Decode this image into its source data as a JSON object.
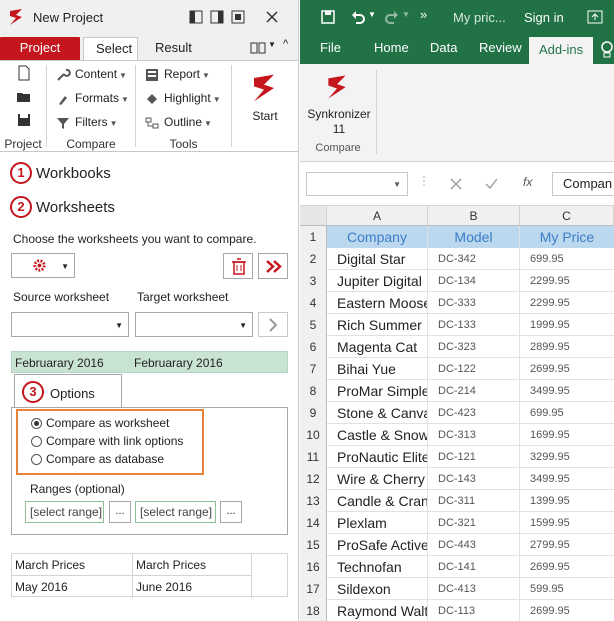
{
  "left": {
    "window_title": "New Project",
    "tabs": [
      "Project",
      "Select",
      "Result"
    ],
    "ribbon": {
      "compare_items": [
        "Content",
        "Formats",
        "Filters"
      ],
      "tools_items": [
        "Report",
        "Highlight",
        "Outline"
      ],
      "start_label": "Start",
      "project_label": "Project",
      "compare_label": "Compare",
      "tools_label": "Tools"
    },
    "steps": [
      {
        "num": "1",
        "label": "Workbooks"
      },
      {
        "num": "2",
        "label": "Worksheets"
      },
      {
        "num": "3",
        "label": "Options"
      }
    ],
    "instruction": "Choose the worksheets you want to compare.",
    "source_label": "Source worksheet",
    "target_label": "Target worksheet",
    "selected_source": "Februarary 2016",
    "selected_target": "Februarary 2016",
    "options": [
      "Compare as worksheet",
      "Compare with link options",
      "Compare as database"
    ],
    "ranges_label": "Ranges (optional)",
    "range_placeholder": "[select range]",
    "browse_label": "...",
    "bottom_rows": [
      [
        "March Prices",
        "March Prices"
      ],
      [
        "May 2016",
        "June 2016"
      ]
    ]
  },
  "right": {
    "title": "My pric...",
    "sign_in": "Sign in",
    "tabs": [
      "File",
      "Home",
      "Data",
      "Review",
      "Add-ins"
    ],
    "addin_label": "Synkronizer 11",
    "addin_group": "Compare",
    "formula_fx": "fx",
    "formula_text": "Compan",
    "columns": [
      "A",
      "B",
      "C"
    ],
    "header": {
      "company": "Company",
      "model": "Model",
      "price": "My Price"
    },
    "rows": [
      {
        "n": "2",
        "company": "Digital Star",
        "model": "DC-342",
        "price": "699.95"
      },
      {
        "n": "3",
        "company": "Jupiter Digital",
        "model": "DC-134",
        "price": "2299.95"
      },
      {
        "n": "4",
        "company": "Eastern Moose",
        "model": "DC-333",
        "price": "2299.95"
      },
      {
        "n": "5",
        "company": "Rich Summer",
        "model": "DC-133",
        "price": "1999.95"
      },
      {
        "n": "6",
        "company": "Magenta Cat",
        "model": "DC-323",
        "price": "2899.95"
      },
      {
        "n": "7",
        "company": "Bihai Yue",
        "model": "DC-122",
        "price": "2699.95"
      },
      {
        "n": "8",
        "company": "ProMar Simple",
        "model": "DC-214",
        "price": "3499.95"
      },
      {
        "n": "9",
        "company": "Stone & Canvas",
        "model": "DC-423",
        "price": "699.95"
      },
      {
        "n": "10",
        "company": "Castle & Snow",
        "model": "DC-313",
        "price": "1699.95"
      },
      {
        "n": "11",
        "company": "ProNautic Elite",
        "model": "DC-121",
        "price": "3299.95"
      },
      {
        "n": "12",
        "company": "Wire & Cherry",
        "model": "DC-143",
        "price": "3499.95"
      },
      {
        "n": "13",
        "company": "Candle & Crane",
        "model": "DC-311",
        "price": "1399.95"
      },
      {
        "n": "14",
        "company": "Plexlam",
        "model": "DC-321",
        "price": "1599.95"
      },
      {
        "n": "15",
        "company": "ProSafe Active F",
        "model": "DC-443",
        "price": "2799.95"
      },
      {
        "n": "16",
        "company": "Technofan",
        "model": "DC-141",
        "price": "2699.95"
      },
      {
        "n": "17",
        "company": "Sildexon",
        "model": "DC-413",
        "price": "599.95"
      },
      {
        "n": "18",
        "company": "Raymond Walter",
        "model": "DC-113",
        "price": "2699.95"
      }
    ]
  }
}
